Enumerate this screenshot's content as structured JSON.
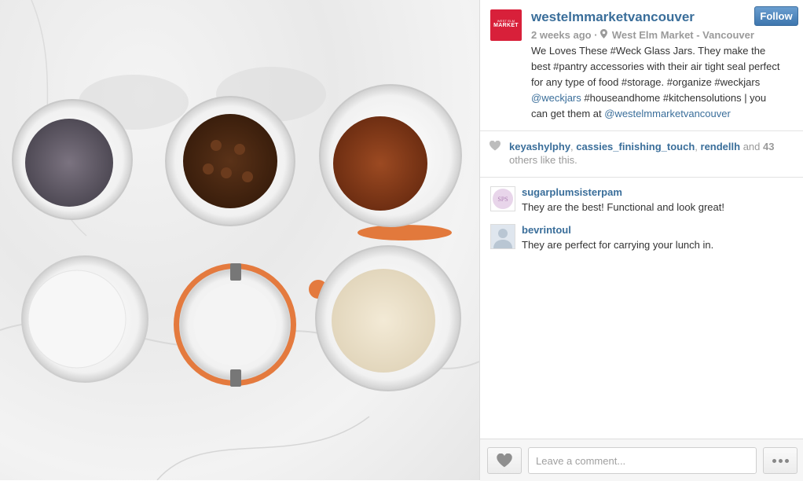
{
  "post": {
    "image_alt": "Six glass jars with lavender, chocolate chips, spice, salt, sugar and flour on marble",
    "author": {
      "username": "westelmmarketvancouver",
      "logo_small": "WEST ELM",
      "logo_text": "MARKET"
    },
    "follow_label": "Follow",
    "time_ago": "2 weeks ago",
    "separator": "·",
    "location": "West Elm Market - Vancouver",
    "caption": {
      "line1": "We Loves These #Weck Glass Jars. They make the",
      "line2": "best #pantry accessories with their air tight seal perfect",
      "line3": "for any type of food #storage. #organize #weckjars",
      "line4_link": "@weckjars",
      "line4_rest": " #houseandhome #kitchensolutions | you",
      "line5_start": "can get them at ",
      "line5_link": "@westelmmarketvancouver"
    },
    "likes": {
      "user1": "keyashylphy",
      "sep1": ", ",
      "user2": "cassies_finishing_touch",
      "sep2": ", ",
      "user3": "rendellh",
      "and": " and ",
      "count": "43",
      "suffix": "others like this."
    },
    "comments": [
      {
        "username": "sugarplumsisterpam",
        "text": "They are the best! Functional and look great!",
        "avatar_initials": "SPS"
      },
      {
        "username": "bevrintoul",
        "text": "They are perfect for carrying your lunch in."
      }
    ],
    "comment_input": {
      "placeholder": "Leave a comment..."
    },
    "icons": {
      "like": "heart-icon",
      "more": "ellipsis-icon",
      "location": "location-pin-icon"
    },
    "colors": {
      "link": "#3a6e9a",
      "follow_button": "#4f86be",
      "logo_bg": "#d8203a"
    }
  }
}
